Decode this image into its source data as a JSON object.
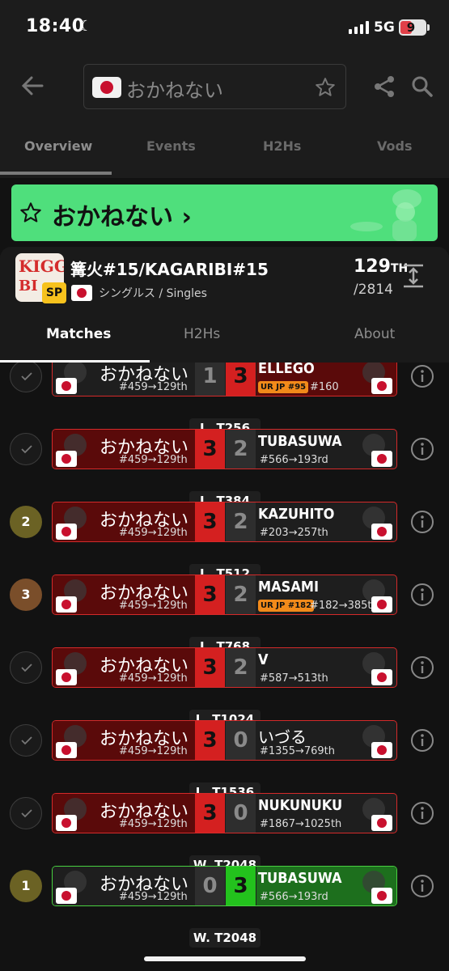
{
  "status": {
    "time": "18:40",
    "network": "5G",
    "battery": "9"
  },
  "search": {
    "query": "おかねない"
  },
  "tabs": [
    "Overview",
    "Events",
    "H2Hs",
    "Vods"
  ],
  "banner": {
    "label": "おかねない ›"
  },
  "tournament": {
    "name": "篝火#15/KAGARIBI#15",
    "badge": "SP",
    "type": "シングルス / Singles",
    "placement": "129",
    "placement_suffix": "TH",
    "entrants": "/2814"
  },
  "subtabs": [
    "Matches",
    "H2Hs",
    "About"
  ],
  "matches": [
    {
      "status": "check",
      "status_text": "",
      "left_name": "おかねない",
      "left_seed": "#459→129th",
      "score_left": "1",
      "score_right": "3",
      "right_name": "ELLEGO",
      "right_badge": "UR JP #95",
      "right_seed": "#160",
      "round": ""
    },
    {
      "status": "check",
      "status_text": "",
      "left_name": "おかねない",
      "left_seed": "#459→129th",
      "score_left": "3",
      "score_right": "2",
      "right_name": "TUBASUWA",
      "right_badge": "",
      "right_seed": "#566→193rd",
      "round": "L. T256"
    },
    {
      "status": "rank",
      "status_text": "2",
      "left_name": "おかねない",
      "left_seed": "#459→129th",
      "score_left": "3",
      "score_right": "2",
      "right_name": "KAZUHITO",
      "right_badge": "",
      "right_seed": "#203→257th",
      "round": "L. T384"
    },
    {
      "status": "rank",
      "status_text": "3",
      "left_name": "おかねない",
      "left_seed": "#459→129th",
      "score_left": "3",
      "score_right": "2",
      "right_name": "MASAMI",
      "right_badge": "UR JP #182",
      "right_seed": "#182→385th",
      "round": "L. T512"
    },
    {
      "status": "check",
      "status_text": "",
      "left_name": "おかねない",
      "left_seed": "#459→129th",
      "score_left": "3",
      "score_right": "2",
      "right_name": "V",
      "right_badge": "",
      "right_seed": "#587→513th",
      "round": "L. T768"
    },
    {
      "status": "check",
      "status_text": "",
      "left_name": "おかねない",
      "left_seed": "#459→129th",
      "score_left": "3",
      "score_right": "0",
      "right_name": "いづる",
      "right_badge": "",
      "right_seed": "#1355→769th",
      "round": "L. T1024"
    },
    {
      "status": "check",
      "status_text": "",
      "left_name": "おかねない",
      "left_seed": "#459→129th",
      "score_left": "3",
      "score_right": "0",
      "right_name": "NUKUNUKU",
      "right_badge": "",
      "right_seed": "#1867→1025th",
      "round": "L. T1536"
    },
    {
      "status": "rank",
      "status_text": "1",
      "left_name": "おかねない",
      "left_seed": "#459→129th",
      "score_left": "0",
      "score_right": "3",
      "right_name": "TUBASUWA",
      "right_badge": "",
      "right_seed": "#566→193rd",
      "round": "W. T2048"
    }
  ],
  "last_round_label": "W. T2048",
  "colors": {
    "accent_green": "#4fdf7c",
    "loss_red": "#d42020",
    "win_green": "#23c21d",
    "rank_gold": "#6b6224",
    "rank_bronze": "#7a4e2a"
  }
}
